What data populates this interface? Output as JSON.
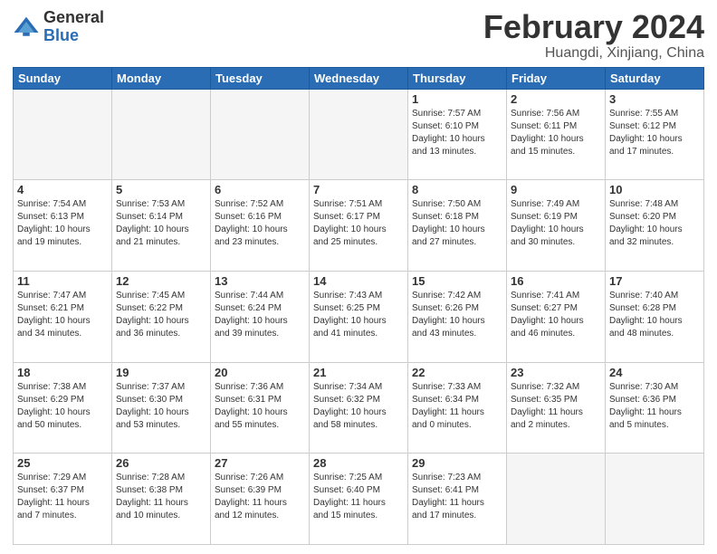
{
  "header": {
    "logo_general": "General",
    "logo_blue": "Blue",
    "title": "February 2024",
    "subtitle": "Huangdi, Xinjiang, China"
  },
  "days_of_week": [
    "Sunday",
    "Monday",
    "Tuesday",
    "Wednesday",
    "Thursday",
    "Friday",
    "Saturday"
  ],
  "weeks": [
    [
      {
        "day": "",
        "info": ""
      },
      {
        "day": "",
        "info": ""
      },
      {
        "day": "",
        "info": ""
      },
      {
        "day": "",
        "info": ""
      },
      {
        "day": "1",
        "info": "Sunrise: 7:57 AM\nSunset: 6:10 PM\nDaylight: 10 hours\nand 13 minutes."
      },
      {
        "day": "2",
        "info": "Sunrise: 7:56 AM\nSunset: 6:11 PM\nDaylight: 10 hours\nand 15 minutes."
      },
      {
        "day": "3",
        "info": "Sunrise: 7:55 AM\nSunset: 6:12 PM\nDaylight: 10 hours\nand 17 minutes."
      }
    ],
    [
      {
        "day": "4",
        "info": "Sunrise: 7:54 AM\nSunset: 6:13 PM\nDaylight: 10 hours\nand 19 minutes."
      },
      {
        "day": "5",
        "info": "Sunrise: 7:53 AM\nSunset: 6:14 PM\nDaylight: 10 hours\nand 21 minutes."
      },
      {
        "day": "6",
        "info": "Sunrise: 7:52 AM\nSunset: 6:16 PM\nDaylight: 10 hours\nand 23 minutes."
      },
      {
        "day": "7",
        "info": "Sunrise: 7:51 AM\nSunset: 6:17 PM\nDaylight: 10 hours\nand 25 minutes."
      },
      {
        "day": "8",
        "info": "Sunrise: 7:50 AM\nSunset: 6:18 PM\nDaylight: 10 hours\nand 27 minutes."
      },
      {
        "day": "9",
        "info": "Sunrise: 7:49 AM\nSunset: 6:19 PM\nDaylight: 10 hours\nand 30 minutes."
      },
      {
        "day": "10",
        "info": "Sunrise: 7:48 AM\nSunset: 6:20 PM\nDaylight: 10 hours\nand 32 minutes."
      }
    ],
    [
      {
        "day": "11",
        "info": "Sunrise: 7:47 AM\nSunset: 6:21 PM\nDaylight: 10 hours\nand 34 minutes."
      },
      {
        "day": "12",
        "info": "Sunrise: 7:45 AM\nSunset: 6:22 PM\nDaylight: 10 hours\nand 36 minutes."
      },
      {
        "day": "13",
        "info": "Sunrise: 7:44 AM\nSunset: 6:24 PM\nDaylight: 10 hours\nand 39 minutes."
      },
      {
        "day": "14",
        "info": "Sunrise: 7:43 AM\nSunset: 6:25 PM\nDaylight: 10 hours\nand 41 minutes."
      },
      {
        "day": "15",
        "info": "Sunrise: 7:42 AM\nSunset: 6:26 PM\nDaylight: 10 hours\nand 43 minutes."
      },
      {
        "day": "16",
        "info": "Sunrise: 7:41 AM\nSunset: 6:27 PM\nDaylight: 10 hours\nand 46 minutes."
      },
      {
        "day": "17",
        "info": "Sunrise: 7:40 AM\nSunset: 6:28 PM\nDaylight: 10 hours\nand 48 minutes."
      }
    ],
    [
      {
        "day": "18",
        "info": "Sunrise: 7:38 AM\nSunset: 6:29 PM\nDaylight: 10 hours\nand 50 minutes."
      },
      {
        "day": "19",
        "info": "Sunrise: 7:37 AM\nSunset: 6:30 PM\nDaylight: 10 hours\nand 53 minutes."
      },
      {
        "day": "20",
        "info": "Sunrise: 7:36 AM\nSunset: 6:31 PM\nDaylight: 10 hours\nand 55 minutes."
      },
      {
        "day": "21",
        "info": "Sunrise: 7:34 AM\nSunset: 6:32 PM\nDaylight: 10 hours\nand 58 minutes."
      },
      {
        "day": "22",
        "info": "Sunrise: 7:33 AM\nSunset: 6:34 PM\nDaylight: 11 hours\nand 0 minutes."
      },
      {
        "day": "23",
        "info": "Sunrise: 7:32 AM\nSunset: 6:35 PM\nDaylight: 11 hours\nand 2 minutes."
      },
      {
        "day": "24",
        "info": "Sunrise: 7:30 AM\nSunset: 6:36 PM\nDaylight: 11 hours\nand 5 minutes."
      }
    ],
    [
      {
        "day": "25",
        "info": "Sunrise: 7:29 AM\nSunset: 6:37 PM\nDaylight: 11 hours\nand 7 minutes."
      },
      {
        "day": "26",
        "info": "Sunrise: 7:28 AM\nSunset: 6:38 PM\nDaylight: 11 hours\nand 10 minutes."
      },
      {
        "day": "27",
        "info": "Sunrise: 7:26 AM\nSunset: 6:39 PM\nDaylight: 11 hours\nand 12 minutes."
      },
      {
        "day": "28",
        "info": "Sunrise: 7:25 AM\nSunset: 6:40 PM\nDaylight: 11 hours\nand 15 minutes."
      },
      {
        "day": "29",
        "info": "Sunrise: 7:23 AM\nSunset: 6:41 PM\nDaylight: 11 hours\nand 17 minutes."
      },
      {
        "day": "",
        "info": ""
      },
      {
        "day": "",
        "info": ""
      }
    ]
  ]
}
